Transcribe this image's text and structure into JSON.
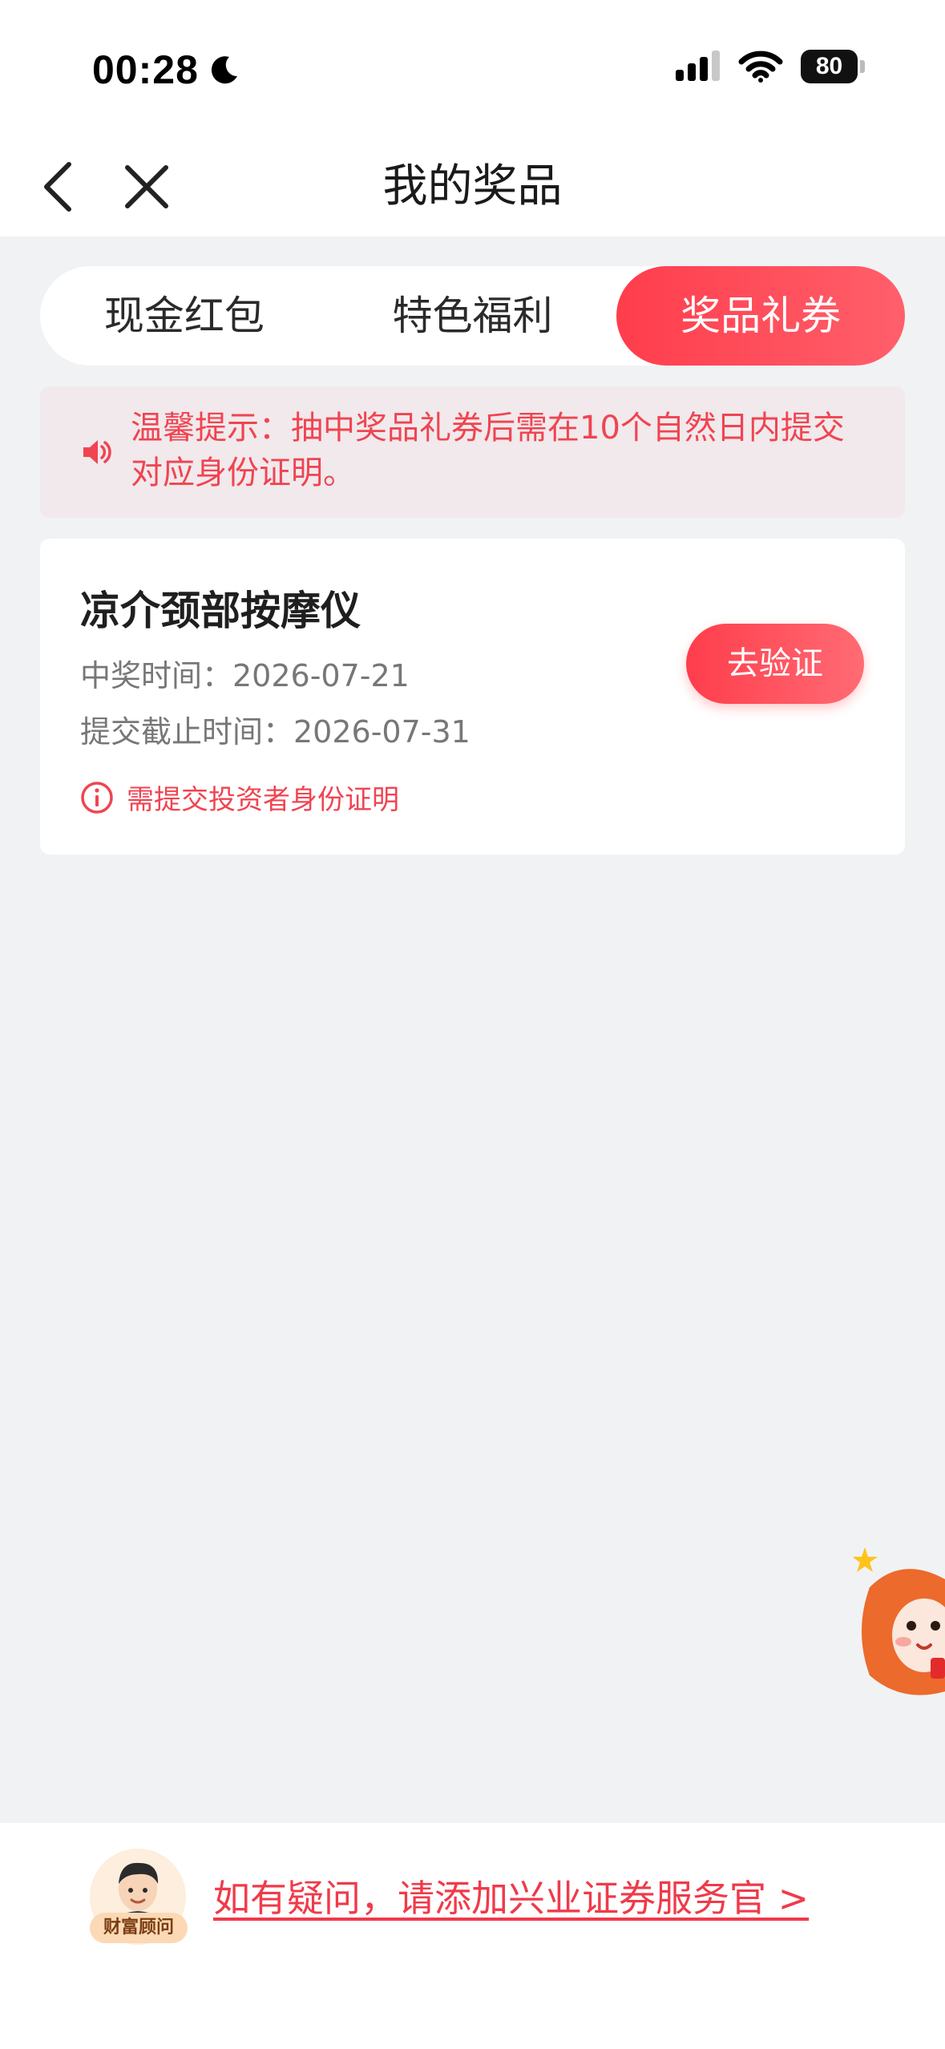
{
  "status_bar": {
    "time": "00:28",
    "battery": "80"
  },
  "nav": {
    "title": "我的奖品"
  },
  "tabs": [
    {
      "label": "现金红包",
      "active": false
    },
    {
      "label": "特色福利",
      "active": false
    },
    {
      "label": "奖品礼券",
      "active": true
    }
  ],
  "notice": {
    "line1": "温馨提示：抽中奖品礼券后需在10个自然日内提交",
    "line2": "对应身份证明。"
  },
  "prize": {
    "name": "凉介颈部按摩仪",
    "win_time": "中奖时间：2026-07-21",
    "deadline": "提交截止时间：2026-07-31",
    "requirement": "需提交投资者身份证明",
    "verify_label": "去验证"
  },
  "footer": {
    "advisor_badge": "财富顾问",
    "help_link": "如有疑问，请添加兴业证券服务官 >"
  },
  "colors": {
    "accent": "#ff3d4c",
    "notice_bg": "#f1e9ec",
    "page_bg": "#f1f2f4"
  }
}
